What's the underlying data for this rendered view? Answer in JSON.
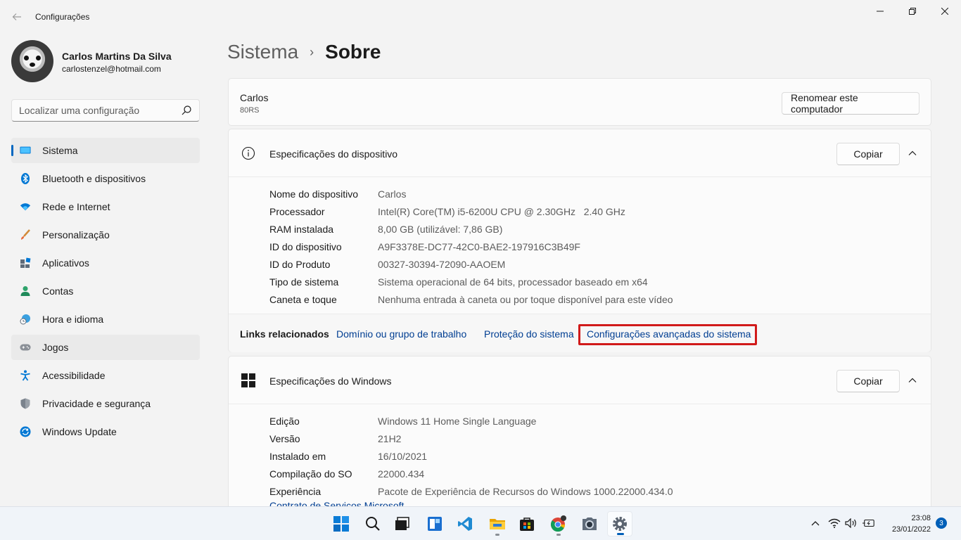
{
  "window": {
    "title": "Configurações"
  },
  "user": {
    "name": "Carlos Martins Da Silva",
    "email": "carlostenzel@hotmail.com"
  },
  "search": {
    "placeholder": "Localizar uma configuração"
  },
  "sidebar": {
    "items": [
      {
        "label": "Sistema",
        "icon": "monitor-icon"
      },
      {
        "label": "Bluetooth e dispositivos",
        "icon": "bluetooth-icon"
      },
      {
        "label": "Rede e Internet",
        "icon": "wifi-icon"
      },
      {
        "label": "Personalização",
        "icon": "brush-icon"
      },
      {
        "label": "Aplicativos",
        "icon": "apps-icon"
      },
      {
        "label": "Contas",
        "icon": "person-icon"
      },
      {
        "label": "Hora e idioma",
        "icon": "globe-clock-icon"
      },
      {
        "label": "Jogos",
        "icon": "gamepad-icon"
      },
      {
        "label": "Acessibilidade",
        "icon": "accessibility-icon"
      },
      {
        "label": "Privacidade e segurança",
        "icon": "shield-icon"
      },
      {
        "label": "Windows Update",
        "icon": "update-icon"
      }
    ]
  },
  "breadcrumb": {
    "parent": "Sistema",
    "separator": "›",
    "current": "Sobre"
  },
  "computer": {
    "name": "Carlos",
    "model": "80RS",
    "rename_label": "Renomear este computador"
  },
  "device_specs": {
    "title": "Especificações do dispositivo",
    "copy_label": "Copiar",
    "rows": [
      {
        "label": "Nome do dispositivo",
        "value": "Carlos"
      },
      {
        "label": "Processador",
        "value": "Intel(R) Core(TM) i5-6200U CPU @ 2.30GHz   2.40 GHz"
      },
      {
        "label": "RAM instalada",
        "value": "8,00 GB (utilizável: 7,86 GB)"
      },
      {
        "label": "ID do dispositivo",
        "value": "A9F3378E-DC77-42C0-BAE2-197916C3B49F"
      },
      {
        "label": "ID do Produto",
        "value": "00327-30394-72090-AAOEM"
      },
      {
        "label": "Tipo de sistema",
        "value": "Sistema operacional de 64 bits, processador baseado em x64"
      },
      {
        "label": "Caneta e toque",
        "value": "Nenhuma entrada à caneta ou por toque disponível para este vídeo"
      }
    ]
  },
  "related": {
    "title": "Links relacionados",
    "links": [
      "Domínio ou grupo de trabalho",
      "Proteção do sistema",
      "Configurações avançadas do sistema"
    ]
  },
  "windows_specs": {
    "title": "Especificações do Windows",
    "copy_label": "Copiar",
    "rows": [
      {
        "label": "Edição",
        "value": "Windows 11 Home Single Language"
      },
      {
        "label": "Versão",
        "value": "21H2"
      },
      {
        "label": "Instalado em",
        "value": "16/10/2021"
      },
      {
        "label": "Compilação do SO",
        "value": "22000.434"
      },
      {
        "label": "Experiência",
        "value": "Pacote de Experiência de Recursos do Windows 1000.22000.434.0"
      }
    ],
    "link": "Contrato de Serviços Microsoft"
  },
  "taskbar": {
    "time": "23:08",
    "date": "23/01/2022",
    "notifications": "3"
  },
  "colors": {
    "accent": "#0067c0",
    "highlight": "#d11a1a",
    "link": "#003e92"
  }
}
